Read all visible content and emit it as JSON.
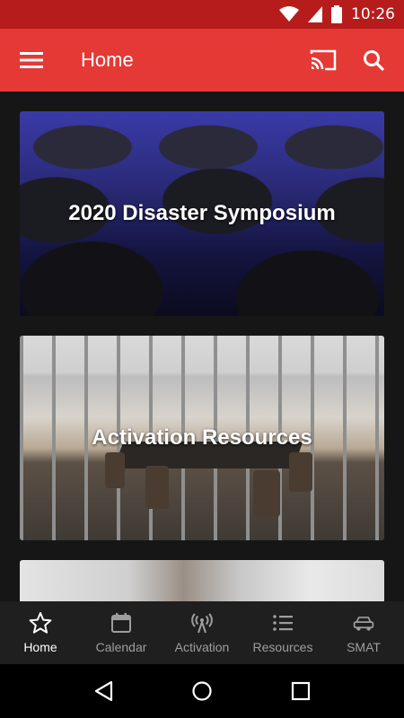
{
  "status_bar": {
    "time": "10:26"
  },
  "app_bar": {
    "title": "Home"
  },
  "cards": [
    {
      "label": "2020 Disaster Symposium"
    },
    {
      "label": "Activation Resources"
    },
    {
      "label": ""
    }
  ],
  "bottom_nav": {
    "items": [
      {
        "label": "Home",
        "icon": "star-icon",
        "active": true
      },
      {
        "label": "Calendar",
        "icon": "calendar-icon",
        "active": false
      },
      {
        "label": "Activation",
        "icon": "broadcast-icon",
        "active": false
      },
      {
        "label": "Resources",
        "icon": "list-icon",
        "active": false
      },
      {
        "label": "SMAT",
        "icon": "car-icon",
        "active": false
      }
    ]
  },
  "colors": {
    "status_bar": "#b71c1c",
    "app_bar": "#e53935",
    "content_bg": "#161616",
    "nav_bg": "#1f1f1f",
    "nav_active": "#ffffff",
    "nav_inactive": "#9e9e9e"
  }
}
